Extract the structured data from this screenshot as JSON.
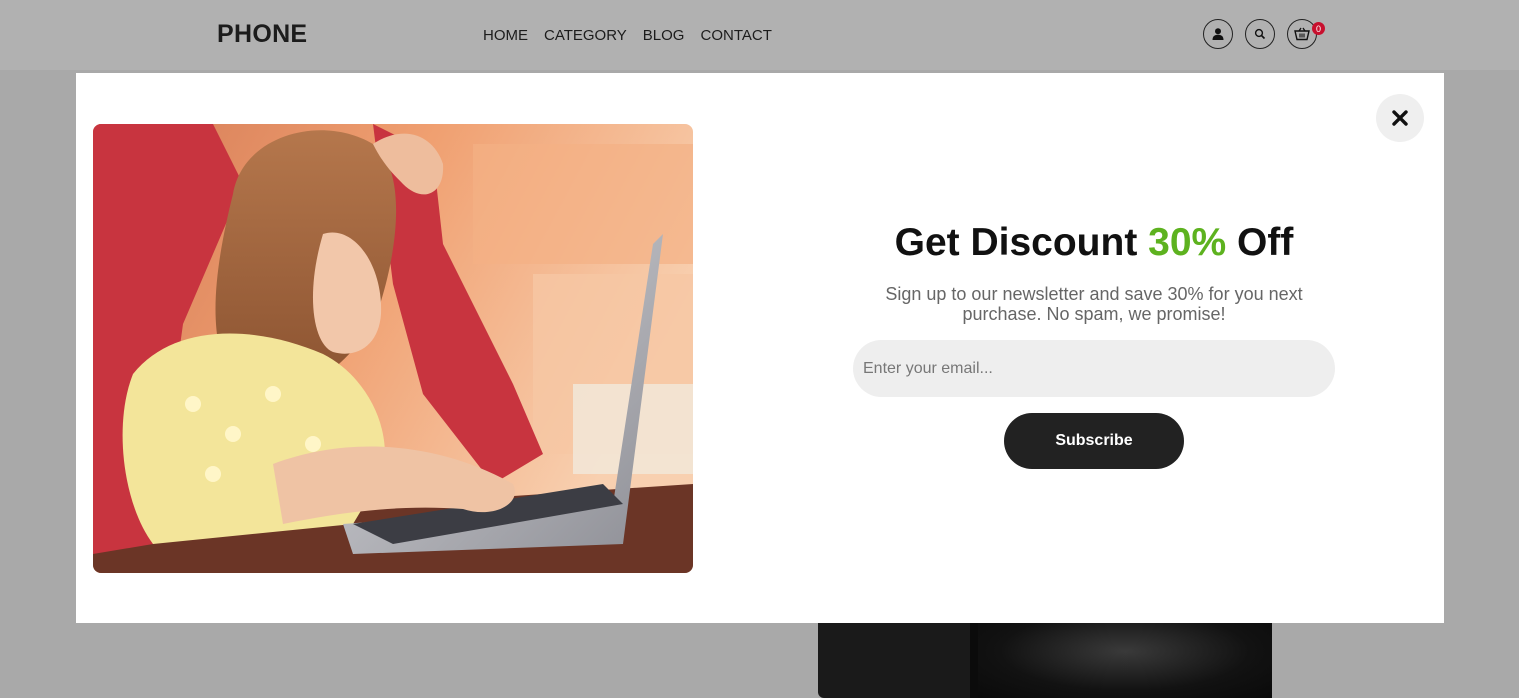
{
  "header": {
    "logo": "PHONE",
    "nav": [
      "HOME",
      "CATEGORY",
      "BLOG",
      "CONTACT"
    ],
    "icons": [
      "user-icon",
      "search-icon",
      "cart-icon"
    ],
    "cart_count": "0"
  },
  "modal": {
    "title_prefix": "Get Discount ",
    "title_highlight": "30%",
    "title_suffix": " Off",
    "subtitle": "Sign up to our newsletter and save 30% for you next purchase. No spam, we promise!",
    "email_placeholder": "Enter your email...",
    "subscribe_label": "Subscribe",
    "accent_color": "#5db21f"
  }
}
